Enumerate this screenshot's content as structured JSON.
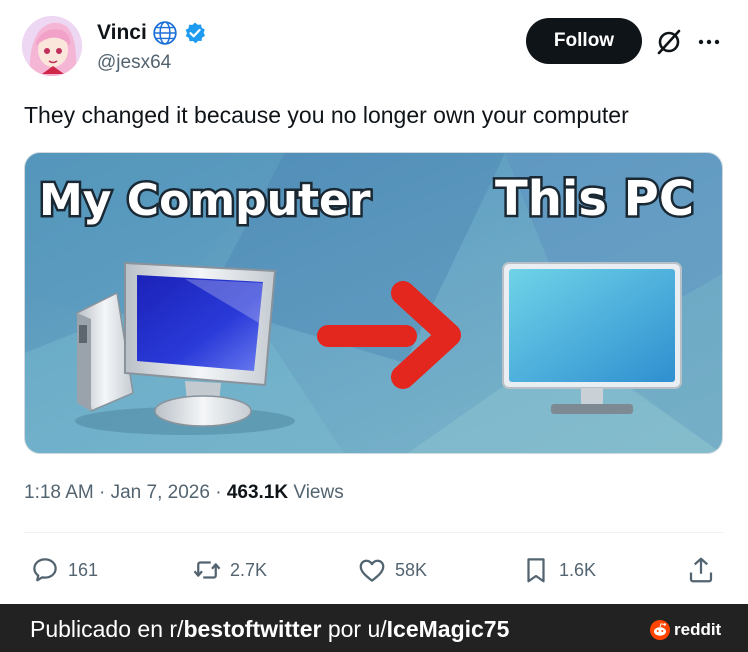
{
  "author": {
    "display_name": "Vinci",
    "handle": "@jesx64",
    "verified": true
  },
  "follow_label": "Follow",
  "tweet_text": "They changed it because you no longer own your computer",
  "media": {
    "left_caption": "My Computer",
    "right_caption": "This PC"
  },
  "meta": {
    "time": "1:18 AM",
    "sep1": " · ",
    "date": "Jan 7, 2026",
    "sep2": " · ",
    "views_count": "463.1K",
    "views_label": " Views"
  },
  "actions": {
    "replies": "161",
    "reposts": "2.7K",
    "likes": "58K",
    "bookmarks": "1.6K"
  },
  "footer": {
    "prefix": "Publicado en r/",
    "subreddit": "bestoftwitter",
    "middle": " por u/",
    "user": "IceMagic75",
    "brand": "reddit"
  },
  "colors": {
    "verified_blue": "#1d9bf0",
    "text_primary": "#0f1419",
    "text_secondary": "#536471",
    "follow_bg": "#0f1419",
    "footer_bg": "#222222",
    "reddit_orange": "#ff4500",
    "arrow_red": "#e3261e"
  }
}
